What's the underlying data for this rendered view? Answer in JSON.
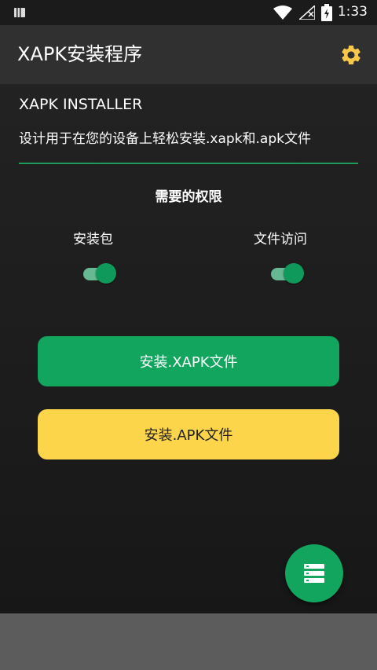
{
  "status_bar": {
    "time": "1:33",
    "battery_icon": "battery-charging-icon",
    "signal_icon": "cellular-off-icon",
    "wifi_icon": "wifi-icon"
  },
  "app_bar": {
    "title": "XAPK安装程序",
    "settings_icon": "gear-icon"
  },
  "header": {
    "subtitle": "XAPK INSTALLER",
    "description": "设计用于在您的设备上轻松安装.xapk和.apk文件"
  },
  "permissions": {
    "title": "需要的权限",
    "items": [
      {
        "label": "安装包",
        "enabled": true
      },
      {
        "label": "文件访问",
        "enabled": true
      }
    ]
  },
  "actions": {
    "install_xapk": "安装.XAPK文件",
    "install_apk": "安装.APK文件"
  },
  "fab": {
    "icon": "storage-list-icon"
  },
  "colors": {
    "accent_green": "#11a55e",
    "accent_yellow": "#fdd54a",
    "gear_yellow": "#f9c84a"
  }
}
